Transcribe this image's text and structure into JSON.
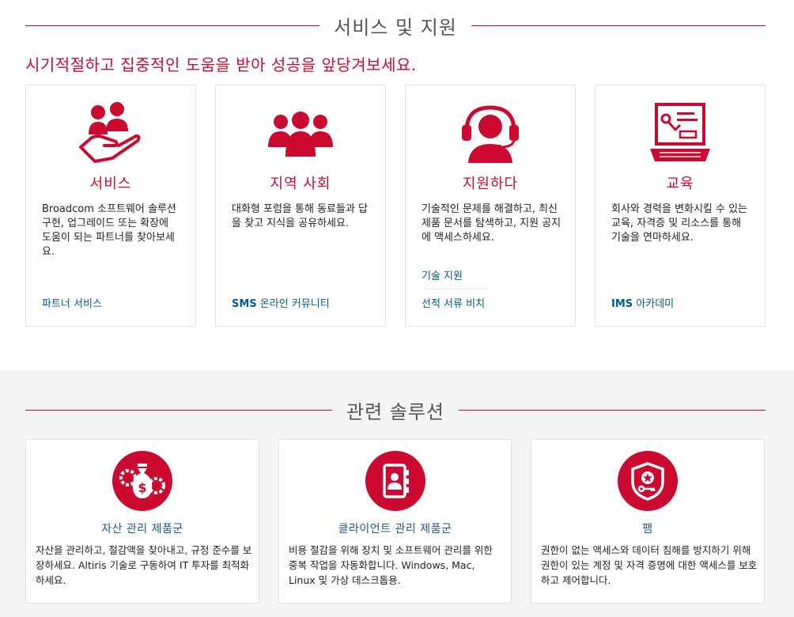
{
  "support": {
    "heading": "서비스 및 지원",
    "tagline": "시기적절하고 집중적인 도움을 받아 성공을 앞당겨보세요.",
    "cards": [
      {
        "title": "서비스",
        "description": "Broadcom 소프트웨어 솔루션 구현, 업그레이드 또는 확장에 도움이 되는 파트너를 찾아보세요.",
        "links": [
          "파트너 서비스"
        ]
      },
      {
        "title": "지역 사회",
        "description": "대화형 포럼을 통해 동료들과 답을 찾고 지식을 공유하세요.",
        "links": [
          {
            "bold": "SMS",
            "rest": " 온라인 커뮤니티"
          }
        ]
      },
      {
        "title": "지원하다",
        "description": "기술적인 문제를 해결하고, 최신 제품 문서를 탐색하고, 지원 공지에 액세스하세요.",
        "links": [
          "기술 지원",
          "선적 서류 비치"
        ]
      },
      {
        "title": "교육",
        "description": "회사와 경력을 변화시킬 수 있는 교육, 자격증 및 리소스를 통해 기술을 연마하세요.",
        "links": [
          {
            "bold": "IMS",
            "rest": " 아카데미"
          }
        ]
      }
    ]
  },
  "solutions": {
    "heading": "관련 솔루션",
    "cards": [
      {
        "title": "자산 관리 제품군",
        "description": "자산을 관리하고, 절감액을 찾아내고, 규정 준수를 보장하세요. Altiris 기술로 구동하여 IT 투자를 최적화하세요."
      },
      {
        "title": "클라이언트 관리 제품군",
        "description": "비용 절감을 위해 장치 및 소프트웨어 관리를 위한 중복 작업을 자동화합니다. Windows, Mac, Linux 및 가상 데스크톱용."
      },
      {
        "title": "팸",
        "description": "권한이 없는 액세스와 데이터 침해를 방지하기 위해 권한이 있는 계정 및 자격 증명에 대한 액세스를 보호하고 제어합니다."
      }
    ]
  },
  "theme": {
    "accent": "#cc0a2f",
    "link": "#005c8a",
    "divider": "#b0103a"
  }
}
